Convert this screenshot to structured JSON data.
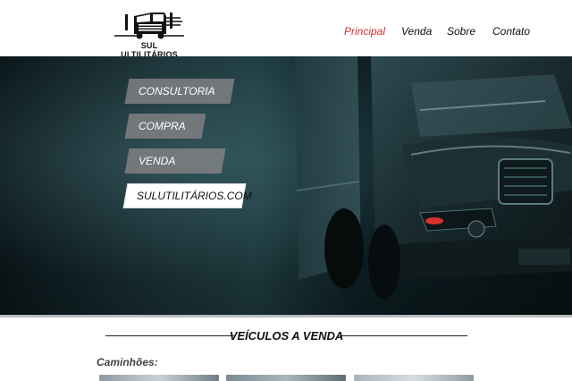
{
  "brand": {
    "name": "SUL ULTILITÁRIOS",
    "logo_icon": "truck-logo-icon"
  },
  "nav": {
    "items": [
      {
        "label": "Principal",
        "active": true
      },
      {
        "label": "Venda",
        "active": false
      },
      {
        "label": "Sobre",
        "active": false
      },
      {
        "label": "Contato",
        "active": false
      }
    ],
    "active_color": "#d32f2f"
  },
  "hero": {
    "menu": [
      {
        "label": "CONSULTORIA"
      },
      {
        "label": "COMPRA"
      },
      {
        "label": "VENDA"
      },
      {
        "label": "SULUTILITÁRIOS.COM"
      }
    ]
  },
  "section": {
    "title": "VEÍCULOS A VENDA",
    "subtitle": "Caminhões:"
  },
  "thumbnails": [
    {
      "name": "vehicle-thumbnail-1"
    },
    {
      "name": "vehicle-thumbnail-2"
    },
    {
      "name": "vehicle-thumbnail-3"
    }
  ]
}
